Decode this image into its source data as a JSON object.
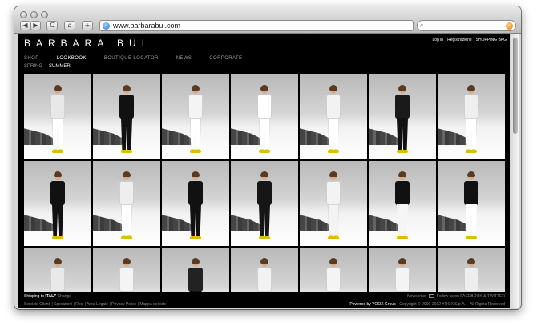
{
  "browser": {
    "url": "www.barbarabui.com",
    "nav_back": "◀",
    "nav_forward": "▶",
    "reload": "C",
    "home": "⌂",
    "add": "+",
    "search_placeholder": ""
  },
  "site": {
    "logo": "BARBARA BUI",
    "top_links": [
      "Log in",
      "Registrazione",
      "SHOPPING BAG"
    ],
    "main_nav": [
      {
        "label": "SHOP",
        "active": false
      },
      {
        "label": "LOOKBOOK",
        "active": true
      },
      {
        "label": "BOUTIQUE LOCATOR",
        "active": false
      },
      {
        "label": "NEWS",
        "active": false
      },
      {
        "label": "CORPORATE",
        "active": false
      }
    ],
    "sub_nav": [
      {
        "label": "SPRING",
        "active": false
      },
      {
        "label": "SUMMER",
        "active": true
      }
    ]
  },
  "looks": [
    {
      "top": "#e8e8e8",
      "bottom": "#ffffff"
    },
    {
      "top": "#111111",
      "bottom": "#111111"
    },
    {
      "top": "#f4f4f4",
      "bottom": "#ffffff"
    },
    {
      "top": "#ffffff",
      "bottom": "#ffffff"
    },
    {
      "top": "#f2f2f2",
      "bottom": "#ffffff"
    },
    {
      "top": "#1a1a1a",
      "bottom": "#111111"
    },
    {
      "top": "#efefef",
      "bottom": "#ffffff"
    },
    {
      "top": "#111111",
      "bottom": "#111111"
    },
    {
      "top": "#eeeeee",
      "bottom": "#ffffff"
    },
    {
      "top": "#111111",
      "bottom": "#111111"
    },
    {
      "top": "#161616",
      "bottom": "#161616"
    },
    {
      "top": "#f3f3f3",
      "bottom": "#f3f3f3"
    },
    {
      "top": "#111111",
      "bottom": "#f5f5f5"
    },
    {
      "top": "#111111",
      "bottom": "#ffffff"
    },
    {
      "top": "#e9e9e9",
      "bottom": "#111111"
    },
    {
      "top": "#f4f4f4",
      "bottom": "#ffffff"
    },
    {
      "top": "#222222",
      "bottom": "#111111"
    },
    {
      "top": "#f2f2f2",
      "bottom": "#ffffff"
    },
    {
      "top": "#f4f4f4",
      "bottom": "#ffffff"
    },
    {
      "top": "#f4f4f4",
      "bottom": "#ffffff"
    },
    {
      "top": "#eeeeee",
      "bottom": "#ffffff"
    }
  ],
  "footer": {
    "shipping_label": "Shipping to",
    "shipping_country": "ITALY",
    "shipping_change": "Change",
    "newsletter": "Newsletter",
    "follow": "Follow us on FACEBOOK & TWITTER",
    "links": "Servizio Clienti | Spedizioni | Resi | Area Legale | Privacy Policy | Mappa del sito",
    "powered_by": "Powered by YOOX Group",
    "copyright": "- Copyright © 2000-2012 YOOX S.p.A. – All Rights Reserved"
  }
}
